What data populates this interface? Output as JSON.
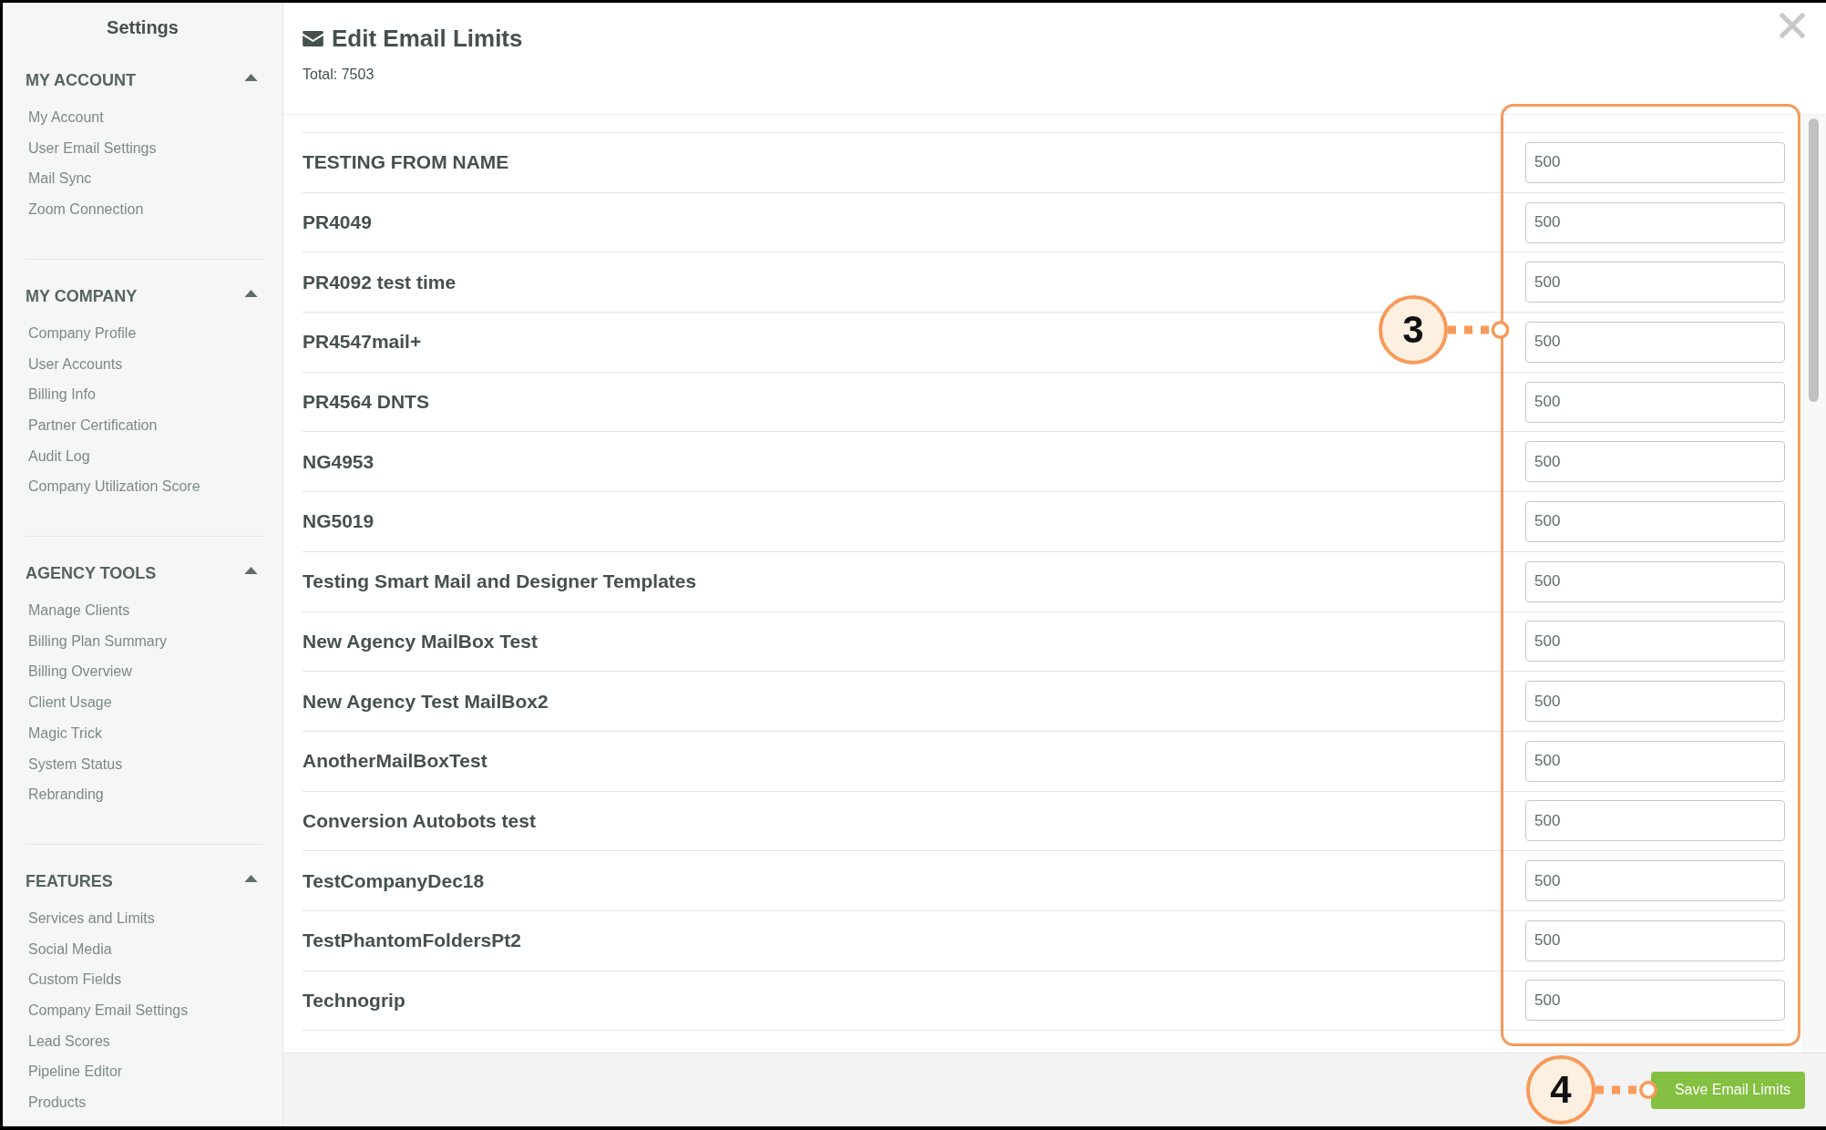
{
  "sidebar": {
    "title": "Settings",
    "sections": [
      {
        "heading": "MY ACCOUNT",
        "expanded": true,
        "items": [
          "My Account",
          "User Email Settings",
          "Mail Sync",
          "Zoom Connection"
        ]
      },
      {
        "heading": "MY COMPANY",
        "expanded": true,
        "items": [
          "Company Profile",
          "User Accounts",
          "Billing Info",
          "Partner Certification",
          "Audit Log",
          "Company Utilization Score"
        ]
      },
      {
        "heading": "AGENCY TOOLS",
        "expanded": true,
        "items": [
          "Manage Clients",
          "Billing Plan Summary",
          "Billing Overview",
          "Client Usage",
          "Magic Trick",
          "System Status",
          "Rebranding"
        ]
      },
      {
        "heading": "FEATURES",
        "expanded": true,
        "items": [
          "Services and Limits",
          "Social Media",
          "Custom Fields",
          "Company Email Settings",
          "Lead Scores",
          "Pipeline Editor",
          "Products"
        ]
      }
    ]
  },
  "dialog": {
    "title": "Edit Email Limits",
    "total": "Total: 7503"
  },
  "limits": [
    {
      "name": "TESTING FROM NAME",
      "value": "500"
    },
    {
      "name": "PR4049",
      "value": "500"
    },
    {
      "name": "PR4092 test time",
      "value": "500"
    },
    {
      "name": "PR4547mail+",
      "value": "500"
    },
    {
      "name": "PR4564 DNTS",
      "value": "500"
    },
    {
      "name": "NG4953",
      "value": "500"
    },
    {
      "name": "NG5019",
      "value": "500"
    },
    {
      "name": "Testing Smart Mail and Designer Templates",
      "value": "500"
    },
    {
      "name": "New Agency MailBox Test",
      "value": "500"
    },
    {
      "name": "New Agency Test MailBox2",
      "value": "500"
    },
    {
      "name": "AnotherMailBoxTest",
      "value": "500"
    },
    {
      "name": "Conversion Autobots test",
      "value": "500"
    },
    {
      "name": "TestCompanyDec18",
      "value": "500"
    },
    {
      "name": "TestPhantomFoldersPt2",
      "value": "500"
    },
    {
      "name": "Technogrip",
      "value": "500"
    }
  ],
  "save_button": "Save Email Limits",
  "annotations": [
    {
      "label": "3"
    },
    {
      "label": "4"
    }
  ]
}
